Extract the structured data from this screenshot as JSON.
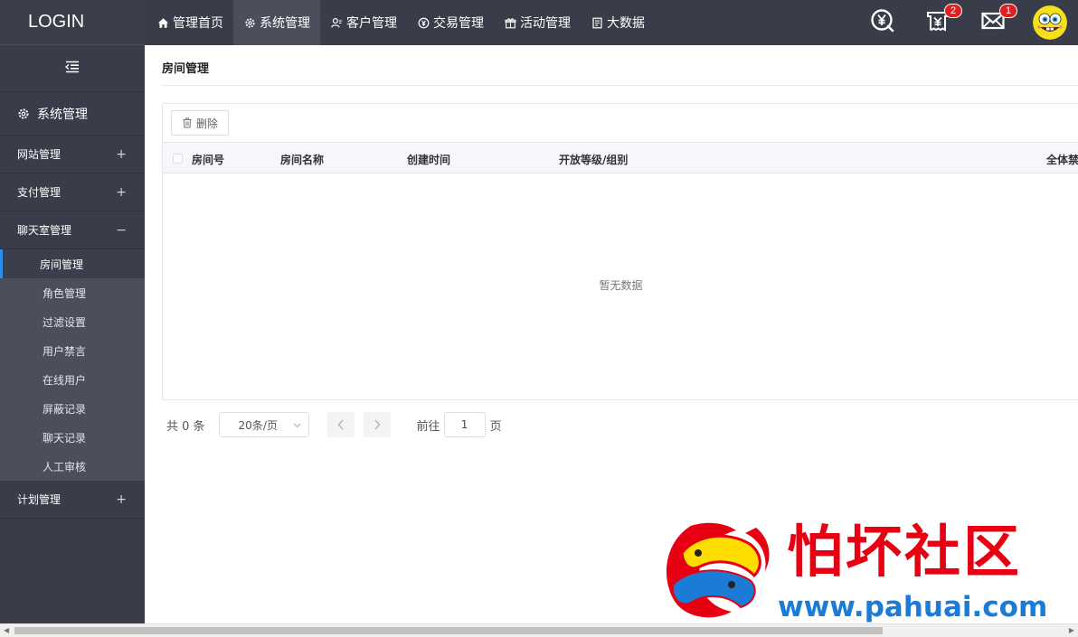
{
  "logo": "LOGIN",
  "topnav": [
    {
      "label": "管理首页",
      "icon": "home-icon",
      "active": false
    },
    {
      "label": "系统管理",
      "icon": "gear-icon",
      "active": true
    },
    {
      "label": "客户管理",
      "icon": "user-icon",
      "active": false
    },
    {
      "label": "交易管理",
      "icon": "yen-circle-icon",
      "active": false
    },
    {
      "label": "活动管理",
      "icon": "gift-icon",
      "active": false
    },
    {
      "label": "大数据",
      "icon": "document-icon",
      "active": false
    }
  ],
  "topright": {
    "receipt_badge": "2",
    "mail_badge": "1"
  },
  "sidebar": {
    "section_title": "系统管理",
    "groups": [
      {
        "label": "网站管理",
        "sign": "+"
      },
      {
        "label": "支付管理",
        "sign": "+"
      },
      {
        "label": "聊天室管理",
        "sign": "−"
      }
    ],
    "sub_items": [
      {
        "label": "房间管理",
        "active": true
      },
      {
        "label": "角色管理",
        "active": false
      },
      {
        "label": "过滤设置",
        "active": false
      },
      {
        "label": "用户禁言",
        "active": false
      },
      {
        "label": "在线用户",
        "active": false
      },
      {
        "label": "屏蔽记录",
        "active": false
      },
      {
        "label": "聊天记录",
        "active": false
      },
      {
        "label": "人工审核",
        "active": false
      }
    ],
    "last_group": {
      "label": "计划管理",
      "sign": "+"
    }
  },
  "main": {
    "page_title": "房间管理",
    "delete_button": "删除",
    "columns": [
      "房间号",
      "房间名称",
      "创建时间",
      "开放等级/组别",
      "全体禁"
    ],
    "empty_text": "暂无数据",
    "pager": {
      "total": "共 0 条",
      "page_size": "20条/页",
      "goto_label": "前往",
      "current_page": "1",
      "page_suffix": "页"
    }
  },
  "watermark": {
    "text_cn": "怕坏社区",
    "url": "www.pahuai.com"
  },
  "colors": {
    "topbar": "#393d49",
    "sidebar": "#393d49",
    "submenu": "#4b4f5b",
    "accent": "#2d8cf0",
    "badge": "#e02020",
    "watermark_red": "#e60012",
    "watermark_blue": "#1a7cd6"
  }
}
